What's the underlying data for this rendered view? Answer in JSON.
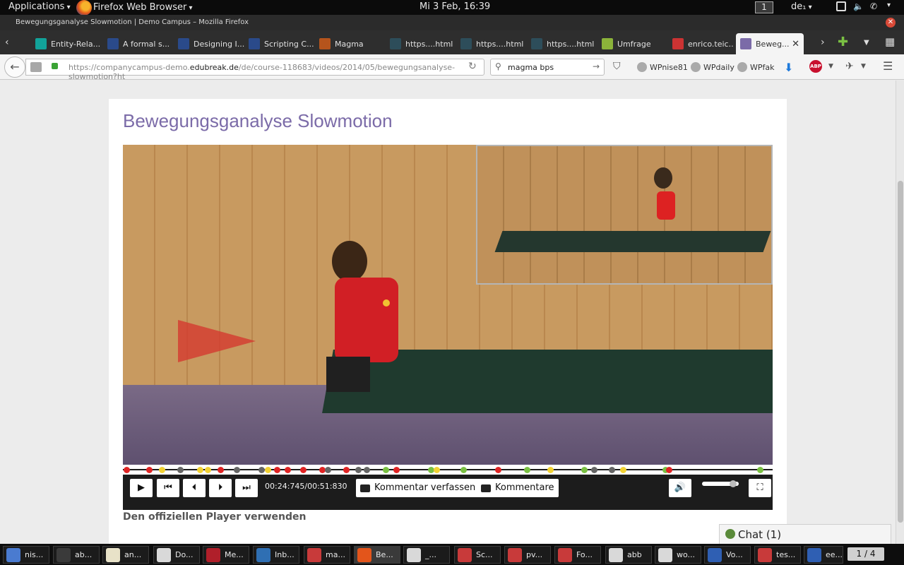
{
  "desktop": {
    "applications_label": "Applications",
    "active_app": "Firefox Web Browser",
    "clock": "Mi 3 Feb, 16:39",
    "workspace": "1",
    "keyboard_layout": "de₁"
  },
  "window": {
    "title": "Bewegungsganalyse Slowmotion | Demo Campus – Mozilla Firefox"
  },
  "tabs": [
    {
      "label": "Entity-Rela...",
      "icon": "researchgate-icon",
      "color": "#12a39a"
    },
    {
      "label": "A formal s...",
      "icon": "sciencedirect-icon",
      "color": "#2a4a8a"
    },
    {
      "label": "Designing I...",
      "icon": "sciencedirect-icon",
      "color": "#2a4a8a"
    },
    {
      "label": "Scripting C...",
      "icon": "sciencedirect-icon",
      "color": "#2a4a8a"
    },
    {
      "label": "Magma",
      "icon": "magma-icon",
      "color": "#b5541c"
    },
    {
      "label": "https....html",
      "icon": "hourglass-icon",
      "color": "#2d4d5a"
    },
    {
      "label": "https....html",
      "icon": "hourglass-icon",
      "color": "#2d4d5a"
    },
    {
      "label": "https....html",
      "icon": "hourglass-icon",
      "color": "#2d4d5a"
    },
    {
      "label": "Umfrage",
      "icon": "survey-icon",
      "color": "#8bb33a"
    },
    {
      "label": "enrico.teic...",
      "icon": "page-icon",
      "color": "#c33"
    },
    {
      "label": "Beweg...",
      "icon": "edubreak-icon",
      "color": "#7b6ba8",
      "active": true
    }
  ],
  "navbar": {
    "url_prefix": "https://companycampus-demo.",
    "url_domain": "edubreak.de",
    "url_path": "/de/course-118683/videos/2014/05/bewegungsanalyse-slowmotion?ht",
    "search_value": "magma bps",
    "bookmarks": [
      "WPnise81",
      "WPdaily",
      "WPfak"
    ]
  },
  "page": {
    "title": "Bewegungsganalyse Slowmotion",
    "official_player_link": "Den offiziellen Player verwenden"
  },
  "player": {
    "time": "00:24:745/00:51:830",
    "write_comment": "Kommentar verfassen",
    "comments": "Kommentare",
    "volume_fraction": 0.85,
    "marker_colors": {
      "red": "#e02424",
      "yellow": "#f2d234",
      "grey": "#666666",
      "green": "#7ac043"
    },
    "markers": [
      {
        "pos": 0.005,
        "c": "red"
      },
      {
        "pos": 0.04,
        "c": "red"
      },
      {
        "pos": 0.06,
        "c": "yellow"
      },
      {
        "pos": 0.088,
        "c": "grey"
      },
      {
        "pos": 0.118,
        "c": "yellow"
      },
      {
        "pos": 0.13,
        "c": "yellow"
      },
      {
        "pos": 0.15,
        "c": "red"
      },
      {
        "pos": 0.175,
        "c": "grey"
      },
      {
        "pos": 0.213,
        "c": "grey"
      },
      {
        "pos": 0.223,
        "c": "yellow"
      },
      {
        "pos": 0.237,
        "c": "red"
      },
      {
        "pos": 0.253,
        "c": "red"
      },
      {
        "pos": 0.277,
        "c": "red"
      },
      {
        "pos": 0.306,
        "c": "red"
      },
      {
        "pos": 0.315,
        "c": "grey"
      },
      {
        "pos": 0.344,
        "c": "red"
      },
      {
        "pos": 0.362,
        "c": "grey"
      },
      {
        "pos": 0.375,
        "c": "grey"
      },
      {
        "pos": 0.404,
        "c": "green"
      },
      {
        "pos": 0.421,
        "c": "red"
      },
      {
        "pos": 0.474,
        "c": "green"
      },
      {
        "pos": 0.483,
        "c": "yellow"
      },
      {
        "pos": 0.524,
        "c": "green"
      },
      {
        "pos": 0.577,
        "c": "red"
      },
      {
        "pos": 0.622,
        "c": "green"
      },
      {
        "pos": 0.658,
        "c": "yellow"
      },
      {
        "pos": 0.71,
        "c": "green"
      },
      {
        "pos": 0.725,
        "c": "grey"
      },
      {
        "pos": 0.752,
        "c": "grey"
      },
      {
        "pos": 0.77,
        "c": "yellow"
      },
      {
        "pos": 0.835,
        "c": "green"
      },
      {
        "pos": 0.84,
        "c": "red"
      },
      {
        "pos": 0.98,
        "c": "green"
      }
    ]
  },
  "chat": {
    "label": "Chat (1)"
  },
  "taskbar": [
    {
      "label": "nis...",
      "icon": "chromium-icon",
      "color": "#4a7bd0"
    },
    {
      "label": "ab...",
      "icon": "terminal-icon",
      "color": "#3a3a3a"
    },
    {
      "label": "an...",
      "icon": "text-editor-icon",
      "color": "#e8e2c8"
    },
    {
      "label": "Do...",
      "icon": "document-viewer-icon",
      "color": "#d9d9d9"
    },
    {
      "label": "Me...",
      "icon": "mendeley-icon",
      "color": "#b01f2a"
    },
    {
      "label": "Inb...",
      "icon": "thunderbird-icon",
      "color": "#2f6fb3"
    },
    {
      "label": "ma...",
      "icon": "pdf-icon",
      "color": "#c83a3a"
    },
    {
      "label": "Be...",
      "icon": "firefox-icon",
      "color": "#e3551b",
      "active": true
    },
    {
      "label": "_...",
      "icon": "document-viewer-icon",
      "color": "#d9d9d9"
    },
    {
      "label": "Sc...",
      "icon": "pdf-icon",
      "color": "#c83a3a"
    },
    {
      "label": "pv...",
      "icon": "pdf-icon",
      "color": "#c83a3a"
    },
    {
      "label": "Fo...",
      "icon": "pdf-icon",
      "color": "#c83a3a"
    },
    {
      "label": "abb",
      "icon": "document-viewer-icon",
      "color": "#d9d9d9"
    },
    {
      "label": "wo...",
      "icon": "document-viewer-icon",
      "color": "#d9d9d9"
    },
    {
      "label": "Vo...",
      "icon": "writer-icon",
      "color": "#2f5fb3"
    },
    {
      "label": "tes...",
      "icon": "pdf-icon",
      "color": "#c83a3a"
    },
    {
      "label": "ee...",
      "icon": "writer-icon",
      "color": "#2f5fb3"
    }
  ],
  "pager": "1 / 4"
}
